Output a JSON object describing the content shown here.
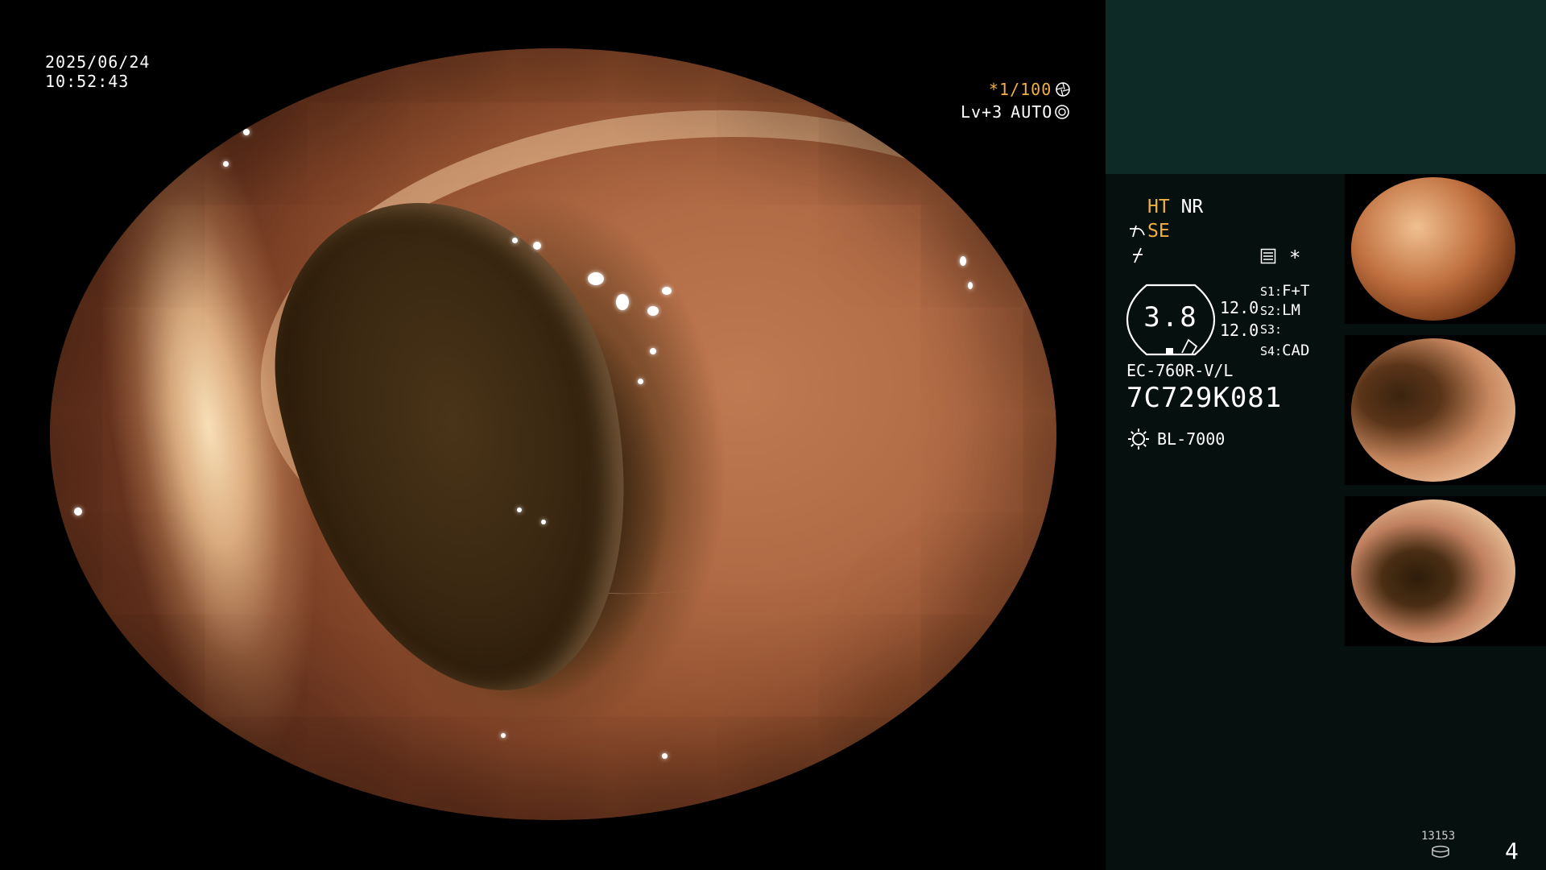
{
  "overlay": {
    "date": "2025/06/24",
    "time": "10:52:43",
    "shutter": "*1/100",
    "level": "Lv+3",
    "iris": "AUTO"
  },
  "settings": {
    "ht": "HT",
    "nr": "NR",
    "se": "SE",
    "magnification": "3.8",
    "value_top": "12.0",
    "value_bottom": "12.0",
    "s1": "S1:",
    "s1_value": "F+T",
    "s2": "S2:",
    "s2_value": "LM",
    "s3": "S3:",
    "s4": "S4:",
    "s4_value": "CAD",
    "asterisk": "*",
    "scope_model": "EC-760R-V/L",
    "scope_serial": "7C729K081",
    "light_source": "BL-7000"
  },
  "footer": {
    "count": "13153",
    "page": "4"
  },
  "colors": {
    "panel_top": "#0d2a26",
    "panel_bottom": "#06100f",
    "accent_orange": "#f0b040"
  },
  "icons": [
    "aperture-icon",
    "iris-icon",
    "structure-enhance-icon",
    "color-enhance-icon",
    "menu-list-icon",
    "light-sun-icon",
    "database-disk-icon"
  ]
}
